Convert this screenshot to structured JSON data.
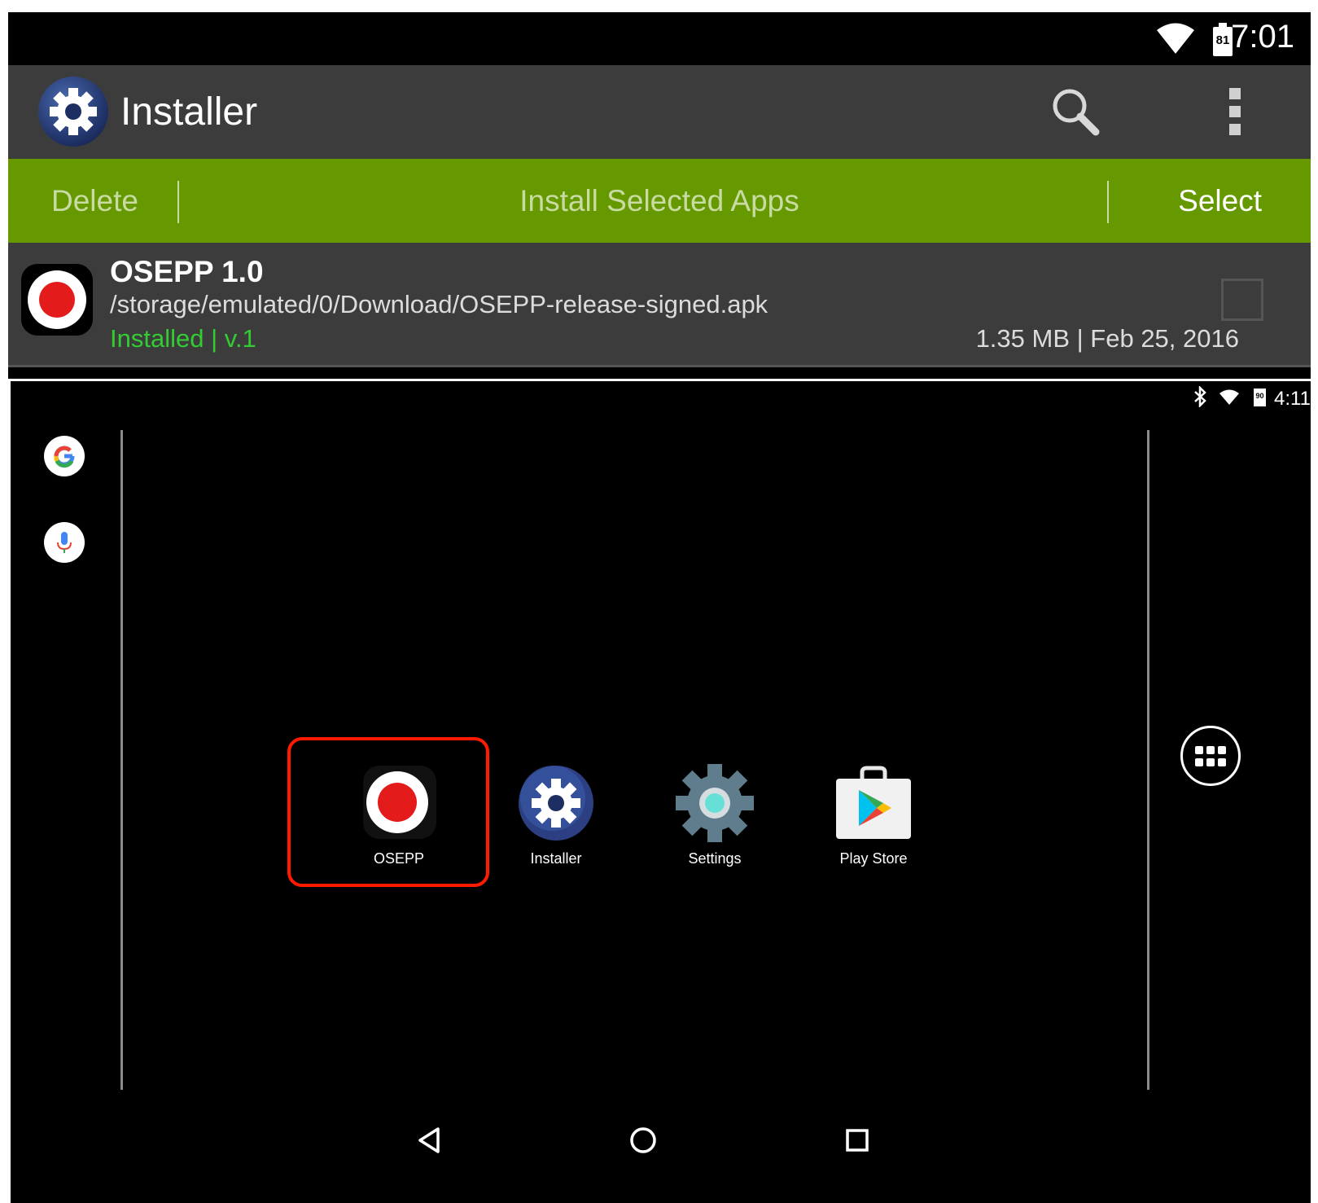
{
  "top": {
    "status_bar": {
      "time": "7:01",
      "battery_level": "81",
      "wifi_icon": "wifi-icon"
    },
    "app_bar": {
      "title": "Installer",
      "icons": [
        "installer-gear-icon",
        "search-icon",
        "overflow-menu-icon"
      ]
    },
    "action_bar": {
      "delete_label": "Delete",
      "install_label": "Install Selected Apps",
      "select_label": "Select"
    },
    "app_item": {
      "name": "OSEPP 1.0",
      "path": "/storage/emulated/0/Download/OSEPP-release-signed.apk",
      "status": "Installed | v.1",
      "meta": "1.35 MB | Feb 25, 2016",
      "checked": false
    },
    "colors": {
      "action_bar": "#669900",
      "status_installed": "#33cc33",
      "app_bar": "#3c3c3c"
    }
  },
  "bottom": {
    "status_bar": {
      "time": "4:11",
      "battery_level": "90",
      "icons": [
        "bluetooth-icon",
        "wifi-icon",
        "battery-icon"
      ]
    },
    "left_rail": [
      "google-search-icon",
      "microphone-icon"
    ],
    "apps": [
      {
        "label": "OSEPP",
        "icon": "osepp-record-icon",
        "highlighted": true
      },
      {
        "label": "Installer",
        "icon": "installer-gear-icon",
        "highlighted": false
      },
      {
        "label": "Settings",
        "icon": "settings-gear-icon",
        "highlighted": false
      },
      {
        "label": "Play Store",
        "icon": "play-store-icon",
        "highlighted": false
      }
    ],
    "nav_bar": [
      "back-icon",
      "home-icon",
      "recents-icon"
    ],
    "app_drawer_icon": "app-drawer-icon",
    "colors": {
      "highlight_border": "#ff1a00"
    }
  }
}
